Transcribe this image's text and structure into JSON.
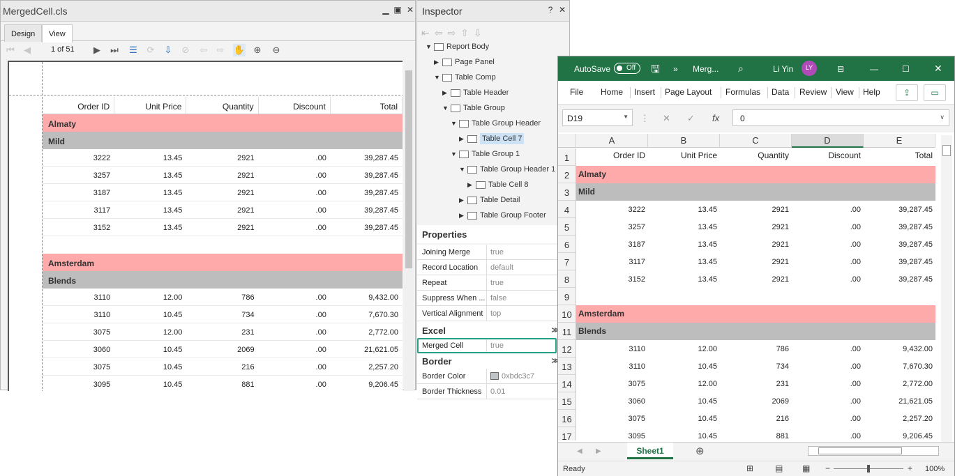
{
  "report": {
    "title": "MergedCell.cls",
    "min": "▁",
    "restore": "▣",
    "close": "✕",
    "tabs": [
      "Design",
      "View"
    ],
    "page_indicator": "1 of 51",
    "columns": [
      "Order ID",
      "Unit Price",
      "Quantity",
      "Discount",
      "Total"
    ],
    "group1": {
      "name": "Almaty",
      "sub": "Mild",
      "rows": [
        [
          "3222",
          "13.45",
          "2921",
          ".00",
          "39,287.45"
        ],
        [
          "3257",
          "13.45",
          "2921",
          ".00",
          "39,287.45"
        ],
        [
          "3187",
          "13.45",
          "2921",
          ".00",
          "39,287.45"
        ],
        [
          "3117",
          "13.45",
          "2921",
          ".00",
          "39,287.45"
        ],
        [
          "3152",
          "13.45",
          "2921",
          ".00",
          "39,287.45"
        ]
      ]
    },
    "group2": {
      "name": "Amsterdam",
      "sub": "Blends",
      "rows": [
        [
          "3110",
          "12.00",
          "786",
          ".00",
          "9,432.00"
        ],
        [
          "3110",
          "10.45",
          "734",
          ".00",
          "7,670.30"
        ],
        [
          "3075",
          "12.00",
          "231",
          ".00",
          "2,772.00"
        ],
        [
          "3060",
          "10.45",
          "2069",
          ".00",
          "21,621.05"
        ],
        [
          "3075",
          "10.45",
          "216",
          ".00",
          "2,257.20"
        ],
        [
          "3095",
          "10.45",
          "881",
          ".00",
          "9,206.45"
        ]
      ]
    }
  },
  "inspector": {
    "title": "Inspector",
    "help": "?",
    "close": "✕",
    "tree": [
      "Report Body",
      "Page Panel",
      "Table Comp",
      "Table Header",
      "Table Group",
      "Table Group Header",
      "Table Cell 7",
      "Table Group 1",
      "Table Group Header 1",
      "Table Cell 8",
      "Table Detail",
      "Table Group Footer"
    ],
    "properties_title": "Properties",
    "props": [
      {
        "name": "Joining Merge",
        "value": "true"
      },
      {
        "name": "Record Location",
        "value": "default"
      },
      {
        "name": "Repeat",
        "value": "true"
      },
      {
        "name": "Suppress When ...",
        "value": "false"
      },
      {
        "name": "Vertical Alignment",
        "value": "top"
      }
    ],
    "excel_title": "Excel",
    "merged_cell": {
      "name": "Merged Cell",
      "value": "true"
    },
    "border_title": "Border",
    "border_props": [
      {
        "name": "Border Color",
        "value": "0xbdc3c7"
      },
      {
        "name": "Border Thickness",
        "value": "0.01"
      }
    ]
  },
  "excel": {
    "autosave": "AutoSave",
    "toggle": "Off",
    "more": "»",
    "filename": "Merg...",
    "user": "Li Yin",
    "initials": "LY",
    "menu": [
      "File",
      "Home",
      "Insert",
      "Page Layout",
      "Formulas",
      "Data",
      "Review",
      "View",
      "Help"
    ],
    "name_box": "D19",
    "fx": "fx",
    "formula_value": "0",
    "col_letters": [
      "A",
      "B",
      "C",
      "D",
      "E"
    ],
    "row_numbers": [
      "1",
      "2",
      "3",
      "4",
      "5",
      "6",
      "7",
      "8",
      "9",
      "10",
      "11",
      "12",
      "13",
      "14",
      "15",
      "16",
      "17"
    ],
    "sheet_tab": "Sheet1",
    "status": "Ready",
    "zoom": "100%",
    "colors": {
      "green": "#217346",
      "group_pink": "#ffaaaa",
      "group_gray": "#bdbdbd",
      "highlight": "#27a08a"
    }
  }
}
